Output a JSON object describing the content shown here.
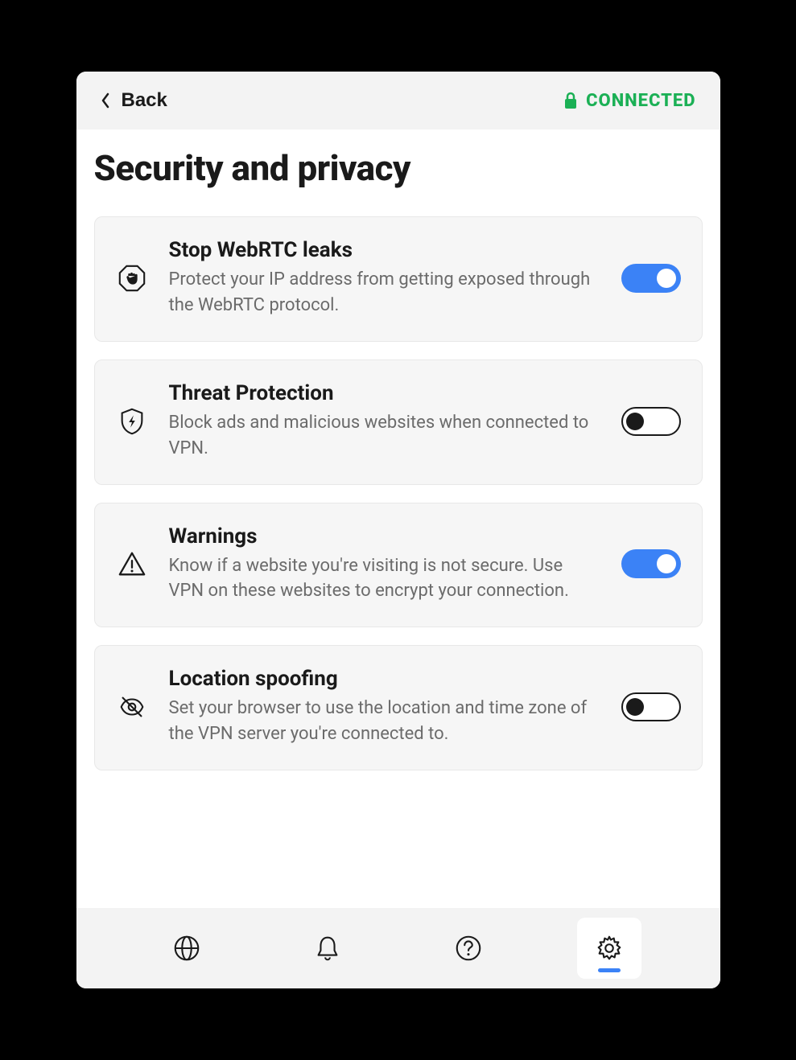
{
  "header": {
    "back_label": "Back",
    "status_label": "CONNECTED"
  },
  "page_title": "Security and privacy",
  "settings": [
    {
      "title": "Stop WebRTC leaks",
      "desc": "Protect your IP address from getting exposed through the WebRTC protocol.",
      "enabled": true
    },
    {
      "title": "Threat Protection",
      "desc": "Block ads and malicious websites when connected to VPN.",
      "enabled": false
    },
    {
      "title": "Warnings",
      "desc": "Know if a website you're visiting is not secure. Use VPN on these websites to encrypt your connection.",
      "enabled": true
    },
    {
      "title": "Location spoofing",
      "desc": "Set your browser to use the location and time zone of the VPN server you're connected to.",
      "enabled": false
    }
  ]
}
